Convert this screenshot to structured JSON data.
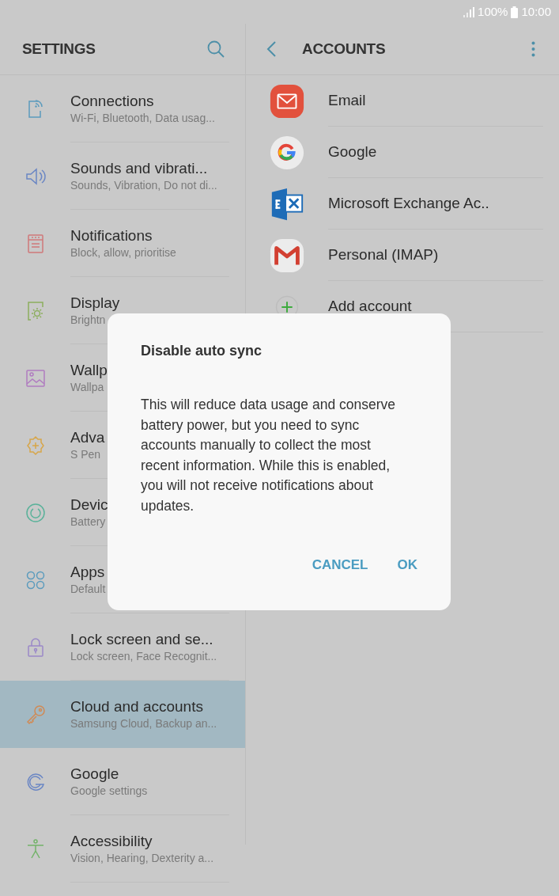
{
  "status_bar": {
    "battery": "100%",
    "time": "10:00"
  },
  "settings_header": {
    "title": "SETTINGS"
  },
  "accounts_header": {
    "title": "ACCOUNTS"
  },
  "sidebar": {
    "items": [
      {
        "title": "Connections",
        "subtitle": "Wi-Fi, Bluetooth, Data usag...",
        "selected": false
      },
      {
        "title": "Sounds and vibrati...",
        "subtitle": "Sounds, Vibration, Do not di...",
        "selected": false
      },
      {
        "title": "Notifications",
        "subtitle": "Block, allow, prioritise",
        "selected": false
      },
      {
        "title": "Display",
        "subtitle": "Brightn",
        "selected": false
      },
      {
        "title": "Wallp",
        "subtitle": "Wallpa",
        "selected": false
      },
      {
        "title": "Adva",
        "subtitle": "S Pen",
        "selected": false
      },
      {
        "title": "Devic",
        "subtitle": "Battery",
        "selected": false
      },
      {
        "title": "Apps",
        "subtitle": "Default",
        "selected": false
      },
      {
        "title": "Lock screen and se...",
        "subtitle": "Lock screen, Face Recognit...",
        "selected": false
      },
      {
        "title": "Cloud and accounts",
        "subtitle": "Samsung Cloud, Backup an...",
        "selected": true
      },
      {
        "title": "Google",
        "subtitle": "Google settings",
        "selected": false
      },
      {
        "title": "Accessibility",
        "subtitle": "Vision, Hearing, Dexterity a...",
        "selected": false
      }
    ]
  },
  "accounts": [
    {
      "kind": "email",
      "label": "Email"
    },
    {
      "kind": "google",
      "label": "Google"
    },
    {
      "kind": "exchange",
      "label": "Microsoft Exchange Ac.."
    },
    {
      "kind": "imap",
      "label": "Personal (IMAP)"
    },
    {
      "kind": "add",
      "label": "Add account"
    }
  ],
  "dialog": {
    "title": "Disable auto sync",
    "message": "This will reduce data usage and conserve battery power, but you need to sync accounts manually to collect the most recent information. While this is enabled, you will not receive notifications about updates.",
    "buttons": [
      "CANCEL",
      "OK"
    ]
  }
}
